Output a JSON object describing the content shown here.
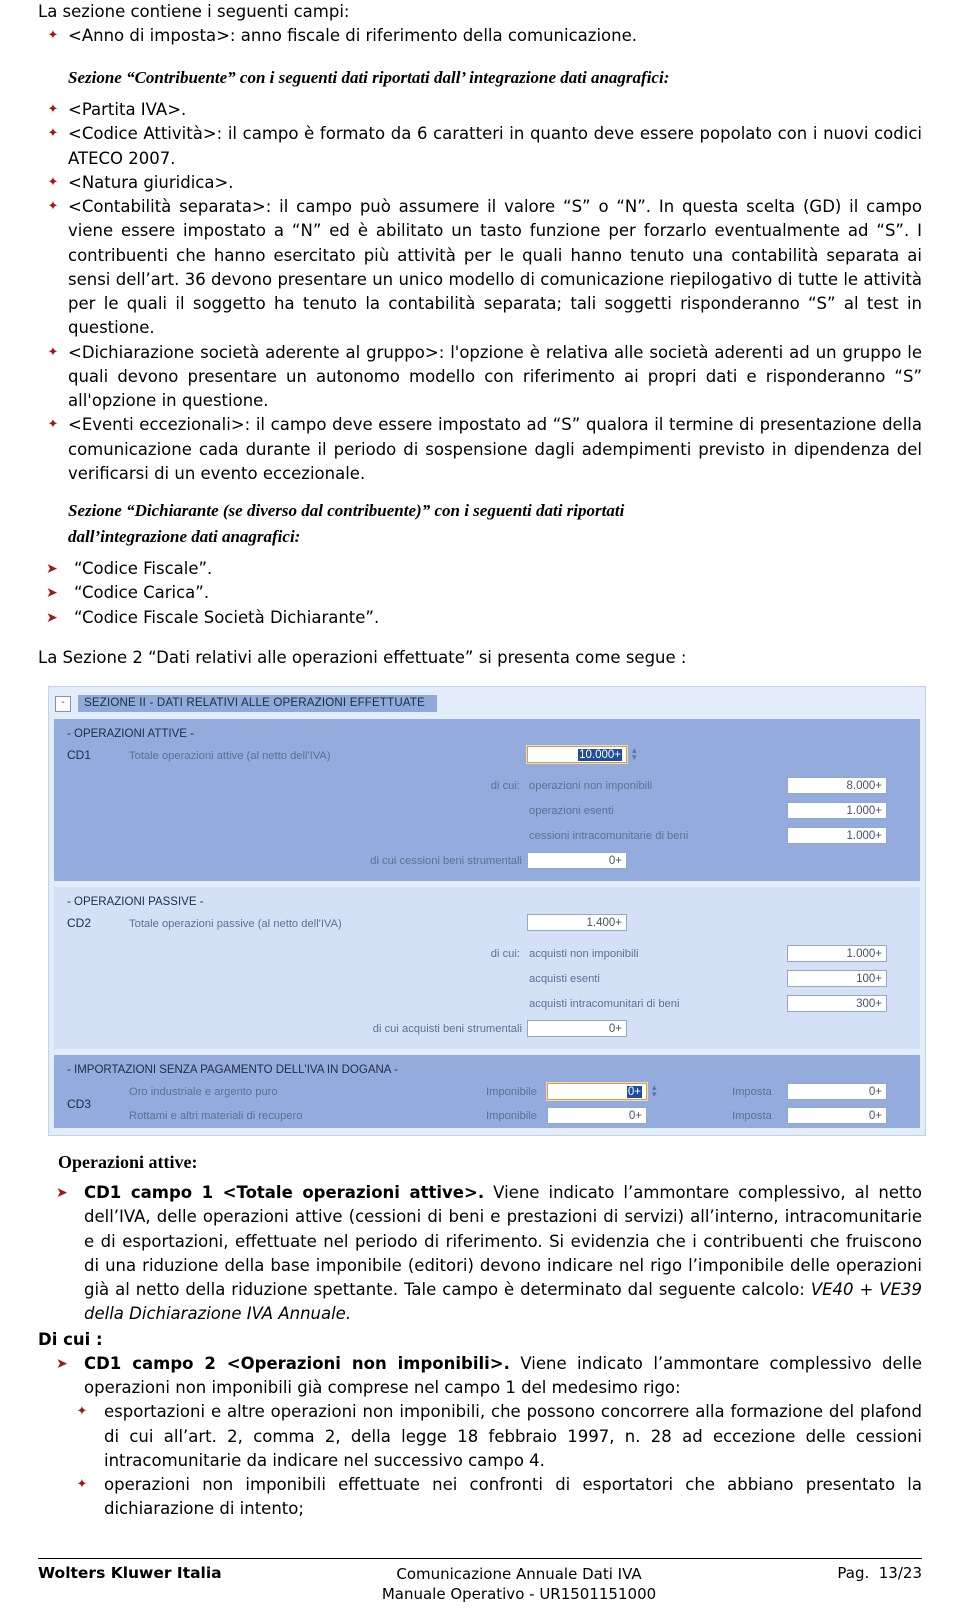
{
  "intro_line": "La sezione contiene i seguenti campi:",
  "fields_list_1": [
    "<Anno di imposta>: anno fiscale di riferimento della comunicazione."
  ],
  "heading_contribuente": "Sezione “Contribuente” con i seguenti dati riportati dall’ integrazione dati anagrafici:",
  "fields_list_2": [
    "<Partita IVA>.",
    "<Codice Attività>: il campo è formato da 6 caratteri in quanto deve essere popolato con i nuovi codici ATECO 2007.",
    "<Natura giuridica>.",
    "<Contabilità separata>: il campo può assumere il valore “S” o “N”. In questa scelta (GD) il campo viene essere impostato a “N” ed è abilitato un tasto funzione per forzarlo eventualmente ad “S”. I contribuenti che hanno esercitato più attività per le quali hanno tenuto una contabilità separata ai sensi dell’art. 36 devono presentare un unico modello di comunicazione riepilogativo di tutte le attività per le quali il soggetto ha tenuto la contabilità separata; tali soggetti risponderanno “S” al test in questione.",
    "<Dichiarazione società aderente al gruppo>: l'opzione è relativa alle società aderenti ad un gruppo le quali devono presentare un autonomo modello con riferimento ai propri dati e risponderanno “S” all'opzione in questione.",
    "<Eventi eccezionali>: il campo deve essere impostato ad “S” qualora il termine di presentazione della comunicazione cada durante il periodo di sospensione dagli adempimenti previsto in dipendenza del verificarsi di un evento eccezionale."
  ],
  "heading_dichiarante_line1": "Sezione “Dichiarante (se diverso dal contribuente)” con i seguenti dati riportati",
  "heading_dichiarante_line2": "dall’integrazione dati anagrafici:",
  "dichiarante_items": [
    "“Codice Fiscale”.",
    "“Codice Carica”.",
    "“Codice Fiscale Società Dichiarante”."
  ],
  "sezione2_lead": "La Sezione 2 “Dati relativi alle operazioni effettuate” si presenta come segue :",
  "screenshot": {
    "collapse_icon": "-",
    "collapse_label": "-",
    "title": "SEZIONE II - DATI RELATIVI ALLE OPERAZIONI EFFETTUATE",
    "panel_active": {
      "legend": "- OPERAZIONI ATTIVE -",
      "code": "CD1",
      "main_label": "Totale operazioni attive (al netto dell'IVA)",
      "main_value": "10.000+",
      "main_value_selected": true,
      "di_cui_label": "di cui:",
      "sub_rows": [
        {
          "label": "operazioni non imponibili",
          "value": "8.000+"
        },
        {
          "label": "operazioni esenti",
          "value": "1.000+"
        },
        {
          "label": "cessioni intracomunitarie di beni",
          "value": "1.000+"
        }
      ],
      "strumentali_label": "di cui cessioni beni strumentali",
      "strumentali_value": "0+"
    },
    "panel_passive": {
      "legend": "- OPERAZIONI PASSIVE -",
      "code": "CD2",
      "main_label": "Totale operazioni passive (al netto dell'IVA)",
      "main_value": "1.400+",
      "di_cui_label": "di cui:",
      "sub_rows": [
        {
          "label": "acquisti non imponibili",
          "value": "1.000+"
        },
        {
          "label": "acquisti esenti",
          "value": "100+"
        },
        {
          "label": "acquisti intracomunitari di beni",
          "value": "300+"
        }
      ],
      "strumentali_label": "di cui acquisti beni strumentali",
      "strumentali_value": "0+"
    },
    "panel_import": {
      "legend": "- IMPORTAZIONI SENZA PAGAMENTO DELL'IVA IN DOGANA -",
      "code": "CD3",
      "rows": [
        {
          "label": "Oro industriale e argento puro",
          "imponibile_label": "Imponibile",
          "imponibile_value": "0+",
          "imponibile_focused": true,
          "imposta_label": "Imposta",
          "imposta_value": "0+"
        },
        {
          "label": "Rottami e altri materiali di recupero",
          "imponibile_label": "Imponibile",
          "imponibile_value": "0+",
          "imponibile_focused": false,
          "imposta_label": "Imposta",
          "imposta_value": "0+"
        }
      ]
    },
    "colors": {
      "panel_dark": "#93abdd",
      "panel_light": "#d3e0f5",
      "container": "#e3ecf9",
      "title_band": "#8fa9d8",
      "selection": "#1f4d9c",
      "focus_border": "#e59b3c"
    }
  },
  "operazioni_attive_heading": "Operazioni attive:",
  "cd1_campo1": {
    "lead": "CD1 campo 1 <Totale operazioni attive>.",
    "text_before": " Viene indicato l’ammontare complessivo, al netto dell’IVA, delle operazioni attive (cessioni di beni e prestazioni di servizi) all’interno, intracomunitarie e di esportazioni, effettuate nel periodo di riferimento. Si evidenzia che i contribuenti che fruiscono di una riduzione della base imponibile (editori) devono indicare nel rigo l’imponibile delle operazioni già al netto della riduzione spettante. Tale campo è determinato dal seguente calcolo: ",
    "formula": "VE40 + VE39 della Dichiarazione IVA Annuale."
  },
  "di_cui_heading": "Di cui :",
  "cd1_campo2": {
    "lead": "CD1 campo 2 <Operazioni non imponibili>.",
    "text": " Viene indicato l’ammontare complessivo delle operazioni non imponibili già comprese nel campo 1 del medesimo rigo:"
  },
  "cd1_campo2_sub": [
    "esportazioni e altre operazioni non imponibili, che possono concorrere alla formazione del plafond di cui all’art. 2, comma 2, della legge 18 febbraio 1997, n. 28 ad eccezione delle cessioni intracomunitarie da indicare nel successivo campo 4.",
    "operazioni non imponibili effettuate nei confronti di esportatori che abbiano presentato la dichiarazione di intento;"
  ],
  "footer": {
    "left": "Wolters Kluwer Italia",
    "mid_line1": "Comunicazione Annuale Dati IVA",
    "mid_line2": "Manuale Operativo - UR1501151000",
    "right": "Pag.  13/23"
  }
}
